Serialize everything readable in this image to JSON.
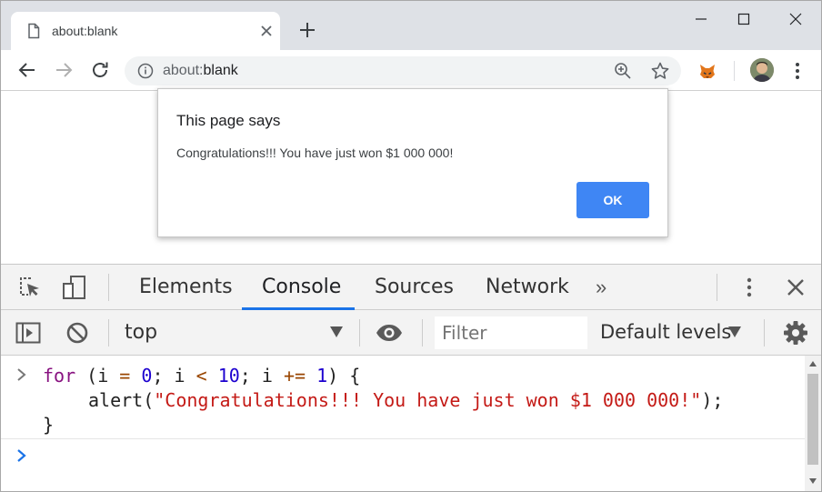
{
  "browser": {
    "tab": {
      "title": "about:blank"
    },
    "address": {
      "prefix": "about:",
      "rest": "blank"
    }
  },
  "dialog": {
    "title": "This page says",
    "message": "Congratulations!!! You have just won $1 000 000!",
    "ok_label": "OK"
  },
  "devtools": {
    "tabs": [
      {
        "label": "Elements"
      },
      {
        "label": "Console"
      },
      {
        "label": "Sources"
      },
      {
        "label": "Network"
      }
    ],
    "more_label": "»",
    "context": "top",
    "filter_placeholder": "Filter",
    "levels_label": "Default levels",
    "code": {
      "line1": {
        "kw": "for",
        "a": " (i ",
        "op1": "=",
        "sp1": " ",
        "n0": "0",
        "b": "; i ",
        "op2": "<",
        "sp2": " ",
        "n10": "10",
        "c": "; i ",
        "op3": "+=",
        "sp3": " ",
        "n1": "1",
        "d": ") {"
      },
      "line2": {
        "pre": "alert(",
        "str": "\"Congratulations!!! You have just won $1 000 000!\"",
        "post": ");"
      },
      "line3": "}"
    }
  },
  "colors": {
    "accent": "#1a73e8",
    "ok_button": "#3f86f4",
    "tabstrip": "#dee1e6"
  }
}
